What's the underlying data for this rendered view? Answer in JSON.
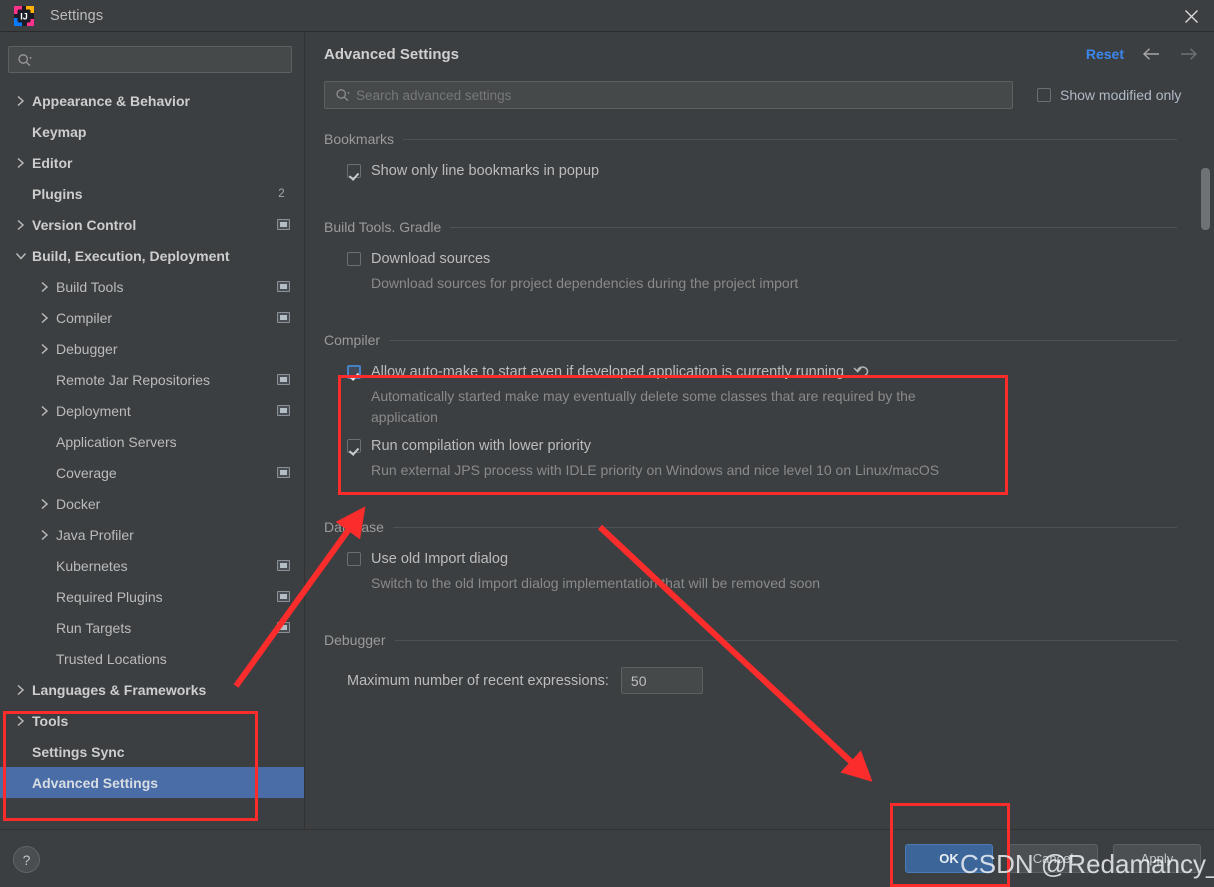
{
  "window": {
    "title": "Settings",
    "app_icon": "intellij-idea-icon",
    "close_icon": "close-icon"
  },
  "colors": {
    "background": "#3c3f41",
    "panel_border": "#323232",
    "selection_blue": "#4a6da7",
    "accent_link": "#3b87f0",
    "checkbox_accent": "#4681c4",
    "annotation_red": "#fb2c2c",
    "primary_button": "#3c6699",
    "text_primary": "#bbbbbb",
    "text_dim": "#8a8a8a"
  },
  "sidebar": {
    "search": {
      "placeholder": "",
      "value": "",
      "icon": "search-icon"
    },
    "items": [
      {
        "label": "Appearance & Behavior",
        "indent": 0,
        "arrow": "collapsed",
        "bold": true,
        "badge": "",
        "selected": false
      },
      {
        "label": "Keymap",
        "indent": 0,
        "arrow": "none",
        "bold": true,
        "badge": "",
        "selected": false
      },
      {
        "label": "Editor",
        "indent": 0,
        "arrow": "collapsed",
        "bold": true,
        "badge": "",
        "selected": false
      },
      {
        "label": "Plugins",
        "indent": 0,
        "arrow": "none",
        "bold": true,
        "badge": "2",
        "selected": false
      },
      {
        "label": "Version Control",
        "indent": 0,
        "arrow": "collapsed",
        "bold": true,
        "badge": "project",
        "selected": false
      },
      {
        "label": "Build, Execution, Deployment",
        "indent": 0,
        "arrow": "expanded",
        "bold": true,
        "badge": "",
        "selected": false
      },
      {
        "label": "Build Tools",
        "indent": 1,
        "arrow": "collapsed",
        "bold": false,
        "badge": "project",
        "selected": false
      },
      {
        "label": "Compiler",
        "indent": 1,
        "arrow": "collapsed",
        "bold": false,
        "badge": "project",
        "selected": false
      },
      {
        "label": "Debugger",
        "indent": 1,
        "arrow": "collapsed",
        "bold": false,
        "badge": "",
        "selected": false
      },
      {
        "label": "Remote Jar Repositories",
        "indent": 1,
        "arrow": "none",
        "bold": false,
        "badge": "project",
        "selected": false
      },
      {
        "label": "Deployment",
        "indent": 1,
        "arrow": "collapsed",
        "bold": false,
        "badge": "project",
        "selected": false
      },
      {
        "label": "Application Servers",
        "indent": 1,
        "arrow": "none",
        "bold": false,
        "badge": "",
        "selected": false
      },
      {
        "label": "Coverage",
        "indent": 1,
        "arrow": "none",
        "bold": false,
        "badge": "project",
        "selected": false
      },
      {
        "label": "Docker",
        "indent": 1,
        "arrow": "collapsed",
        "bold": false,
        "badge": "",
        "selected": false
      },
      {
        "label": "Java Profiler",
        "indent": 1,
        "arrow": "collapsed",
        "bold": false,
        "badge": "",
        "selected": false
      },
      {
        "label": "Kubernetes",
        "indent": 1,
        "arrow": "none",
        "bold": false,
        "badge": "project",
        "selected": false
      },
      {
        "label": "Required Plugins",
        "indent": 1,
        "arrow": "none",
        "bold": false,
        "badge": "project",
        "selected": false
      },
      {
        "label": "Run Targets",
        "indent": 1,
        "arrow": "none",
        "bold": false,
        "badge": "project",
        "selected": false
      },
      {
        "label": "Trusted Locations",
        "indent": 1,
        "arrow": "none",
        "bold": false,
        "badge": "",
        "selected": false
      },
      {
        "label": "Languages & Frameworks",
        "indent": 0,
        "arrow": "collapsed",
        "bold": true,
        "badge": "",
        "selected": false
      },
      {
        "label": "Tools",
        "indent": 0,
        "arrow": "collapsed",
        "bold": true,
        "badge": "",
        "selected": false
      },
      {
        "label": "Settings Sync",
        "indent": 0,
        "arrow": "none",
        "bold": true,
        "badge": "",
        "selected": false
      },
      {
        "label": "Advanced Settings",
        "indent": 0,
        "arrow": "none",
        "bold": true,
        "badge": "",
        "selected": true
      }
    ]
  },
  "main": {
    "title": "Advanced Settings",
    "reset_label": "Reset",
    "back_icon": "arrow-left-icon",
    "forward_icon": "arrow-right-icon",
    "search": {
      "placeholder": "Search advanced settings",
      "value": "",
      "icon": "search-icon"
    },
    "show_modified_only": {
      "label": "Show modified only",
      "checked": false
    },
    "groups": [
      {
        "title": "Bookmarks",
        "options": [
          {
            "label": "Show only line bookmarks in popup",
            "checked": true,
            "accent": false,
            "desc": "",
            "undo": false
          }
        ]
      },
      {
        "title": "Build Tools. Gradle",
        "options": [
          {
            "label": "Download sources",
            "checked": false,
            "accent": false,
            "desc": "Download sources for project dependencies during the project import",
            "undo": false
          }
        ]
      },
      {
        "title": "Compiler",
        "options": [
          {
            "label": "Allow auto-make to start even if developed application is currently running",
            "checked": true,
            "accent": true,
            "desc": "Automatically started make may eventually delete some classes that are required by the application",
            "undo": true
          },
          {
            "label": "Run compilation with lower priority",
            "checked": true,
            "accent": false,
            "desc": "Run external JPS process with IDLE priority on Windows and nice level 10 on Linux/macOS",
            "undo": false
          }
        ]
      },
      {
        "title": "Database",
        "options": [
          {
            "label": "Use old Import dialog",
            "checked": false,
            "accent": false,
            "desc": "Switch to the old Import dialog implementation that will be removed soon",
            "undo": false
          }
        ]
      },
      {
        "title": "Debugger",
        "field": {
          "label": "Maximum number of recent expressions:",
          "value": "50"
        },
        "options": []
      }
    ]
  },
  "footer": {
    "help_label": "?",
    "ok_label": "OK",
    "cancel_label": "Cancel",
    "apply_label": "Apply"
  },
  "annotations": {
    "watermark": "CSDN @Redamancy_早晚",
    "boxes": [
      {
        "name": "compiler-option-highlight"
      },
      {
        "name": "sidebar-advanced-settings-highlight"
      },
      {
        "name": "ok-button-highlight"
      }
    ],
    "arrows": [
      {
        "name": "arrow-to-run-compilation-checkbox"
      },
      {
        "name": "arrow-to-ok-button"
      }
    ]
  }
}
